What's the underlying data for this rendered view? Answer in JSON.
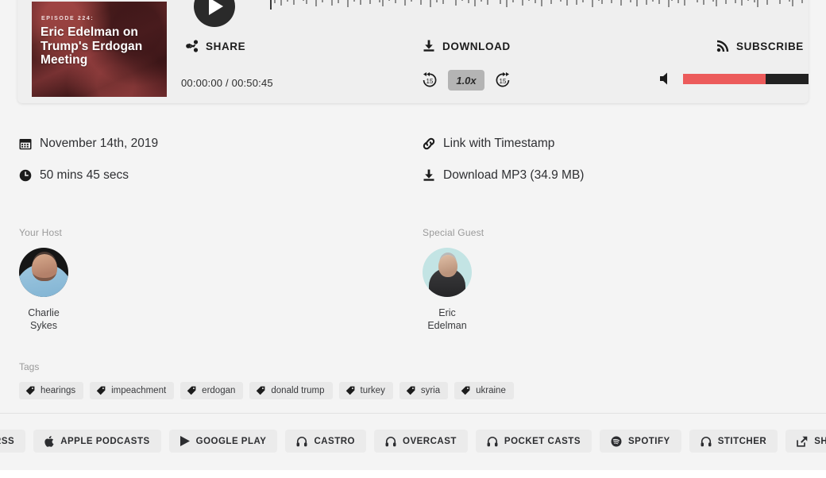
{
  "artwork": {
    "episode_label": "EPISODE 224:",
    "title": "Eric Edelman on Trump's Erdogan Meeting"
  },
  "player": {
    "play_label": "play-button",
    "time_display": "00:00:00 / 00:50:45",
    "current_time": "00:00:00",
    "duration": "00:50:45",
    "rewind_seconds": "15",
    "forward_seconds": "15",
    "speed": "1.0x",
    "volume_percent": 65,
    "volume_fill_color": "#ec5b5b",
    "volume_track_color": "#222222",
    "actions": {
      "share": "SHARE",
      "download": "DOWNLOAD",
      "subscribe": "SUBSCRIBE"
    }
  },
  "meta": {
    "date": "November 14th, 2019",
    "duration_text": "50 mins 45 secs",
    "link_with_timestamp": "Link with Timestamp",
    "download_mp3": "Download MP3 (34.9 MB)"
  },
  "people": {
    "host": {
      "label": "Your Host",
      "first_name": "Charlie",
      "last_name": "Sykes"
    },
    "guest": {
      "label": "Special Guest",
      "first_name": "Eric",
      "last_name": "Edelman"
    }
  },
  "tags": {
    "label": "Tags",
    "items": [
      {
        "label": "hearings"
      },
      {
        "label": "impeachment"
      },
      {
        "label": "erdogan"
      },
      {
        "label": "donald trump"
      },
      {
        "label": "turkey"
      },
      {
        "label": "syria"
      },
      {
        "label": "ukraine"
      }
    ]
  },
  "footer": {
    "buttons": [
      {
        "label": "RSS",
        "icon": "rss-icon"
      },
      {
        "label": "APPLE PODCASTS",
        "icon": "apple-icon"
      },
      {
        "label": "GOOGLE PLAY",
        "icon": "play-triangle-icon"
      },
      {
        "label": "CASTRO",
        "icon": "headphones-icon"
      },
      {
        "label": "OVERCAST",
        "icon": "headphones-icon"
      },
      {
        "label": "POCKET CASTS",
        "icon": "headphones-icon"
      },
      {
        "label": "SPOTIFY",
        "icon": "spotify-icon"
      },
      {
        "label": "STITCHER",
        "icon": "headphones-icon"
      },
      {
        "label": "SHARE",
        "icon": "share-export-icon"
      }
    ]
  }
}
